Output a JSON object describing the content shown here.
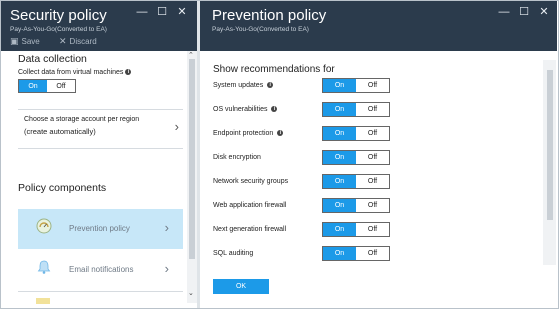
{
  "left_blade": {
    "title": "Security policy",
    "subtitle": "Pay-As-You-Go(Converted to EA)",
    "controls": {
      "minimize": "—",
      "maximize": "☐",
      "close": "✕"
    },
    "commands": {
      "save": "Save",
      "discard": "Discard"
    },
    "data_collection": {
      "heading": "Data collection",
      "label": "Collect data from virtual machines",
      "on": "On",
      "off": "Off",
      "selected": "On"
    },
    "storage": {
      "line1": "Choose a storage account per region",
      "line2": "(create automatically)"
    },
    "policy_components": {
      "heading": "Policy components",
      "items": [
        {
          "label": "Prevention policy",
          "icon": "shield-gauge-icon",
          "active": true
        },
        {
          "label": "Email notifications",
          "icon": "bell-icon",
          "active": false
        }
      ]
    }
  },
  "right_blade": {
    "title": "Prevention policy",
    "subtitle": "Pay-As-You-Go(Converted to EA)",
    "controls": {
      "minimize": "—",
      "maximize": "☐",
      "close": "✕"
    },
    "heading": "Show recommendations for",
    "rows": [
      {
        "name": "System updates",
        "info": true,
        "selected": "On"
      },
      {
        "name": "OS vulnerabilities",
        "info": true,
        "selected": "On"
      },
      {
        "name": "Endpoint protection",
        "info": true,
        "selected": "On"
      },
      {
        "name": "Disk encryption",
        "info": false,
        "selected": "On"
      },
      {
        "name": "Network security groups",
        "info": false,
        "selected": "On"
      },
      {
        "name": "Web application firewall",
        "info": false,
        "selected": "On"
      },
      {
        "name": "Next generation firewall",
        "info": false,
        "selected": "On"
      },
      {
        "name": "SQL auditing",
        "info": false,
        "selected": "On"
      }
    ],
    "on": "On",
    "off": "Off",
    "ok": "OK"
  },
  "colors": {
    "header": "#2b3b4c",
    "accent": "#1c9ae8",
    "active_item": "#c7e7f8"
  }
}
